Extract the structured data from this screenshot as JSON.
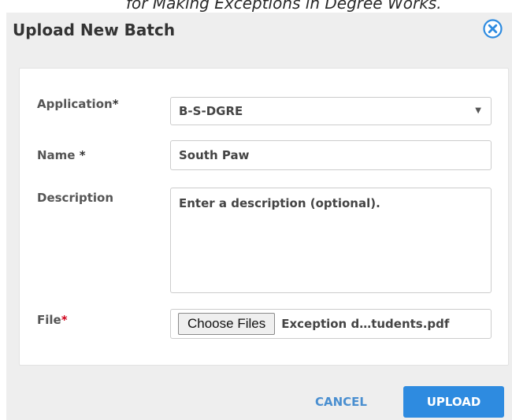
{
  "caption": "for Making Exceptions in Degree Works.",
  "dialog": {
    "title": "Upload New Batch",
    "close_icon": "close-circle-icon"
  },
  "form": {
    "application": {
      "label": "Application",
      "required_mark": "*",
      "selected": "B-S-DGRE",
      "arrow": "▼"
    },
    "name": {
      "label": "Name",
      "required_mark": "*",
      "value": "South Paw"
    },
    "description": {
      "label": "Description",
      "placeholder": "Enter a description (optional)."
    },
    "file": {
      "label": "File",
      "required_mark": "*",
      "button_label": "Choose Files",
      "file_name": "Exception d…tudents.pdf"
    }
  },
  "actions": {
    "cancel": "CANCEL",
    "upload": "UPLOAD"
  },
  "colors": {
    "primary": "#2e8be0",
    "link": "#4a8fd0",
    "required_red": "#d0021b"
  }
}
